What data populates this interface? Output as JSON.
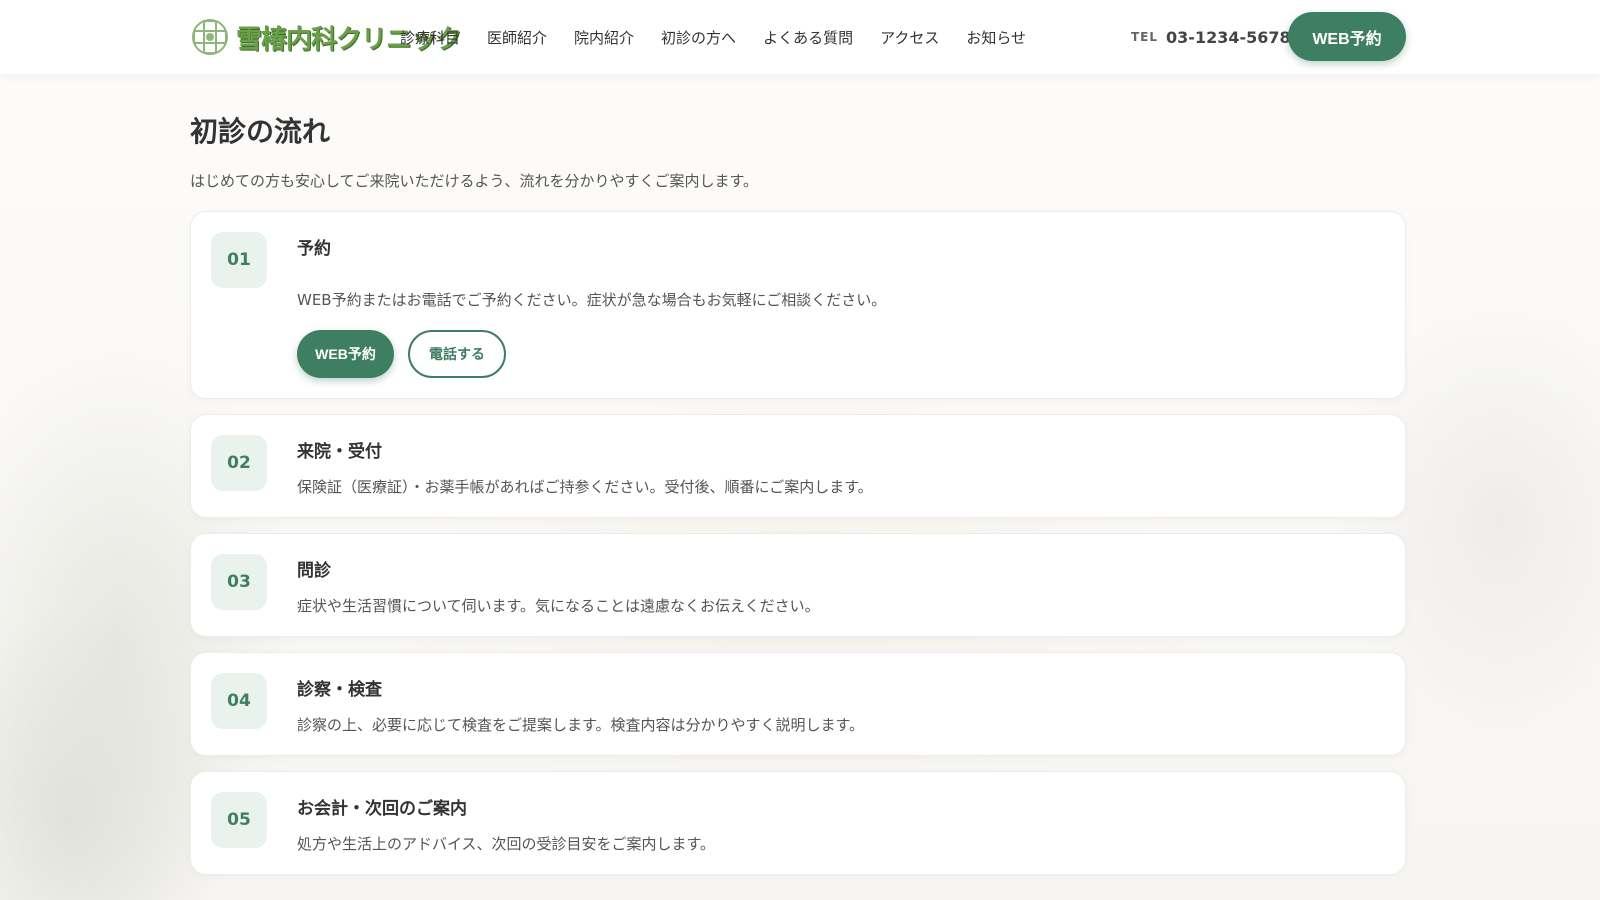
{
  "header": {
    "logo_text": "雪椿内科クリニック",
    "nav": [
      "診療科目",
      "医師紹介",
      "院内紹介",
      "初診の方へ",
      "よくある質問",
      "アクセス",
      "お知らせ"
    ],
    "tel_label": "TEL",
    "tel_number": "03-1234-5678",
    "cta_label": "WEB予約"
  },
  "main": {
    "title": "初診の流れ",
    "lead": "はじめての方も安心してご来院いただけるよう、流れを分かりやすくご案内します。",
    "steps": [
      {
        "num": "01",
        "title": "予約",
        "desc": "WEB予約またはお電話でご予約ください。症状が急な場合もお気軽にご相談ください。",
        "primary_label": "WEB予約",
        "secondary_label": "電話する"
      },
      {
        "num": "02",
        "title": "来院・受付",
        "desc": "保険証（医療証）・お薬手帳があればご持参ください。受付後、順番にご案内します。"
      },
      {
        "num": "03",
        "title": "問診",
        "desc": "症状や生活習慣について伺います。気になることは遠慮なくお伝えください。"
      },
      {
        "num": "04",
        "title": "診察・検査",
        "desc": "診察の上、必要に応じて検査をご提案します。検査内容は分かりやすく説明します。"
      },
      {
        "num": "05",
        "title": "お会計・次回のご案内",
        "desc": "処方や生活上のアドバイス、次回の受診目安をご案内します。"
      }
    ]
  },
  "colors": {
    "accent": "#3e7f63",
    "accent_light": "#eaf2ee",
    "logo_green": "#6aa04a"
  }
}
